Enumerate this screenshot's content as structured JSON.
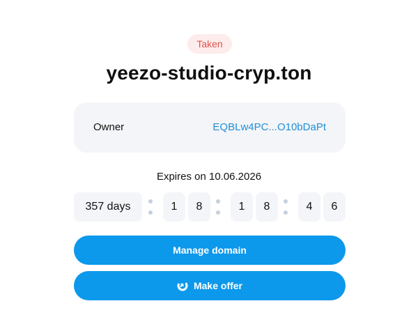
{
  "status": {
    "badge_label": "Taken",
    "badge_color": "#e0534f"
  },
  "domain": {
    "name": "yeezo-studio-cryp.ton"
  },
  "owner": {
    "label": "Owner",
    "address": "EQBLw4PC...O10bDaPt",
    "link_color": "#1f8fd6"
  },
  "expiry": {
    "text": "Expires on 10.06.2026",
    "countdown": {
      "days": "357 days",
      "hours": [
        "1",
        "8"
      ],
      "minutes": [
        "1",
        "8"
      ],
      "seconds": [
        "4",
        "6"
      ]
    }
  },
  "actions": {
    "manage_label": "Manage domain",
    "offer_label": "Make offer",
    "offer_icon": "offer-icon",
    "accent_color": "#0c98eb"
  }
}
